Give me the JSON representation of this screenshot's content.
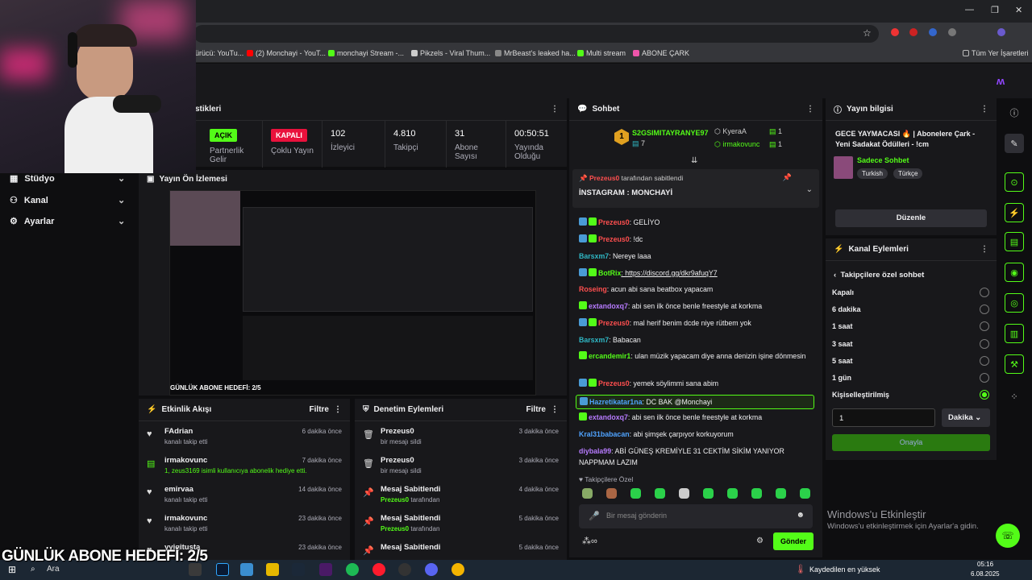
{
  "browser": {
    "bookmarks": [
      "ürücü: YouTu...",
      "(2) Monchayi - YouT...",
      "monchayi Stream -...",
      "Pikzels - Viral Thum...",
      "MrBeast's leaked ha...",
      "Multi stream",
      "ABONE ÇARK"
    ],
    "all_bookmarks": "Tüm Yer İşaretleri"
  },
  "nav": {
    "items": [
      {
        "label": "Stüdyo"
      },
      {
        "label": "Kanal"
      },
      {
        "label": "Ayarlar"
      }
    ]
  },
  "stats": {
    "title": "stikleri",
    "partner_badge": "AÇIK",
    "partner_label": "Partnerlik Gelir",
    "multi_badge": "KAPALI",
    "multi_label": "Çoklu Yayın",
    "viewers_value": "102",
    "viewers_label": "İzleyici",
    "followers_value": "4.810",
    "followers_label": "Takipçi",
    "subs_value": "31",
    "subs_label": "Abone Sayısı",
    "time_value": "00:50:51",
    "time_label": "Yayında Olduğu"
  },
  "preview": {
    "title": "Yayın Ön İzlemesi",
    "overlay": "GÜNLÜK ABONE HEDEFİ: 2/5"
  },
  "activity": {
    "title": "Etkinlik Akışı",
    "filter": "Filtre",
    "rows": [
      {
        "name": "FAdrian",
        "desc": "kanalı takip etti",
        "time": "6 dakika önce"
      },
      {
        "name": "irmakovunc",
        "desc": "1, zeus3169 isimli kullanıcıya abonelik hediye etti.",
        "time": "7 dakika önce"
      },
      {
        "name": "emirvaa",
        "desc": "kanalı takip etti",
        "time": "14 dakika önce"
      },
      {
        "name": "irmakovunc",
        "desc": "kanalı takip etti",
        "time": "23 dakika önce"
      },
      {
        "name": "yyigitusta",
        "desc": "",
        "time": "23 dakika önce"
      }
    ]
  },
  "moderation": {
    "title": "Denetim Eylemleri",
    "filter": "Filtre",
    "rows": [
      {
        "name": "Prezeus0",
        "desc": "bir mesajı sildi",
        "by": "",
        "time": "3 dakika önce"
      },
      {
        "name": "Prezeus0",
        "desc": "bir mesajı sildi",
        "by": "",
        "time": "3 dakika önce"
      },
      {
        "name": "Mesaj Sabitlendi",
        "desc": "tarafından",
        "by": "Prezeus0",
        "time": "4 dakika önce"
      },
      {
        "name": "Mesaj Sabitlendi",
        "desc": "tarafından",
        "by": "Prezeus0",
        "time": "5 dakika önce"
      },
      {
        "name": "Mesaj Sabitlendi",
        "desc": "",
        "by": "",
        "time": "5 dakika önce"
      }
    ]
  },
  "chat": {
    "title": "Sohbet",
    "top_gifter": "S2GSIMITAYRANYE97",
    "top_gifter_count": "7",
    "rank1_badge": "1",
    "gifter2": "KyeraA",
    "gifter2_count": "1",
    "gifter3": "irmakovunc",
    "gifter3_count": "1",
    "pinned_by_user": "Prezeus0",
    "pinned_by_text": "tarafından sabitlendi",
    "pinned_text": "İNSTAGRAM : MONCHAYİ",
    "messages": [
      {
        "user": "Prezeus0",
        "text": ": GELİYO",
        "color": "#ff4f4f"
      },
      {
        "user": "Prezeus0",
        "text": ": !dc",
        "color": "#ff4f4f"
      },
      {
        "user": "Barsxm7",
        "text": ": Nereye laaa",
        "color": "#2fb7c4"
      },
      {
        "user": "BotRix",
        "text": ": https://discord.gg/dkr9afuqY7",
        "color": "#53fc18"
      },
      {
        "user": "Roseing",
        "text": ": acun abi sana beatbox yapacam",
        "color": "#ff4f4f"
      },
      {
        "user": "extandoxq7",
        "text": ": abi sen ilk önce benle freestyle at korkma",
        "color": "#b77bff"
      },
      {
        "user": "Prezeus0",
        "text": ": mal herif benim dcde niye rütbem yok",
        "color": "#ff4f4f"
      },
      {
        "user": "Barsxm7",
        "text": ": Babacan",
        "color": "#2fb7c4"
      },
      {
        "user": "ercandemir1",
        "text": ": ulan müzik yapacam diye anna denizin işine dönmesin",
        "color": "#53fc18"
      },
      {
        "user": "Prezeus0",
        "text": ": yemek söylimmi sana abim",
        "color": "#ff4f4f"
      },
      {
        "user": "Hazretikatar1na",
        "text": ": DC BAK @Monchayi",
        "color": "#4fa3ff"
      },
      {
        "user": "extandoxq7",
        "text": ": abi sen ilk önce benle freestyle at korkma",
        "color": "#b77bff"
      },
      {
        "user": "Kral31babacan",
        "text": ": abi şimşek çarpıyor korkuyorum",
        "color": "#4fa3ff"
      },
      {
        "user": "diybala99",
        "text": ": ABİ GÜNEŞ KREMİYLE 31 CEKTİM SİKİM YANIYOR NAPPMAM LAZIM",
        "color": "#b77bff"
      }
    ],
    "followers_only": "Takipçilere Özel",
    "input_placeholder": "Bir mesaj gönderin",
    "send": "Gönder"
  },
  "stream_info": {
    "title": "Yayın bilgisi",
    "stream_title": "GECE YAYMACASI 🔥 | Abonelere Çark - Yeni Sadakat Ödülleri - !cm",
    "category": "Sadece Sohbet",
    "tags": [
      "Turkish",
      "Türkçe"
    ],
    "edit": "Düzenle"
  },
  "channel_actions": {
    "title": "Kanal Eylemleri",
    "sub_title": "Takipçilere özel sohbet",
    "options": [
      "Kapalı",
      "6 dakika",
      "1 saat",
      "3 saat",
      "5 saat",
      "1 gün",
      "Kişiselleştirilmiş"
    ],
    "selected_index": 6,
    "amount": "1",
    "unit": "Dakika",
    "confirm": "Onayla"
  },
  "windows": {
    "activate_title": "Windows'u Etkinleştir",
    "activate_sub": "Windows'u etkinleştirmek için Ayarlar'a gidin.",
    "search": "Ara",
    "weather": "Kaydedilen en yüksek",
    "time": "05:16",
    "date": "6.08.2025"
  },
  "overlay": {
    "goal": "GÜNLÜK ABONE HEDEFİ: 2/5"
  },
  "colors": {
    "kick_green": "#53fc18",
    "panel": "#18181b",
    "bg": "#0e0e10"
  }
}
